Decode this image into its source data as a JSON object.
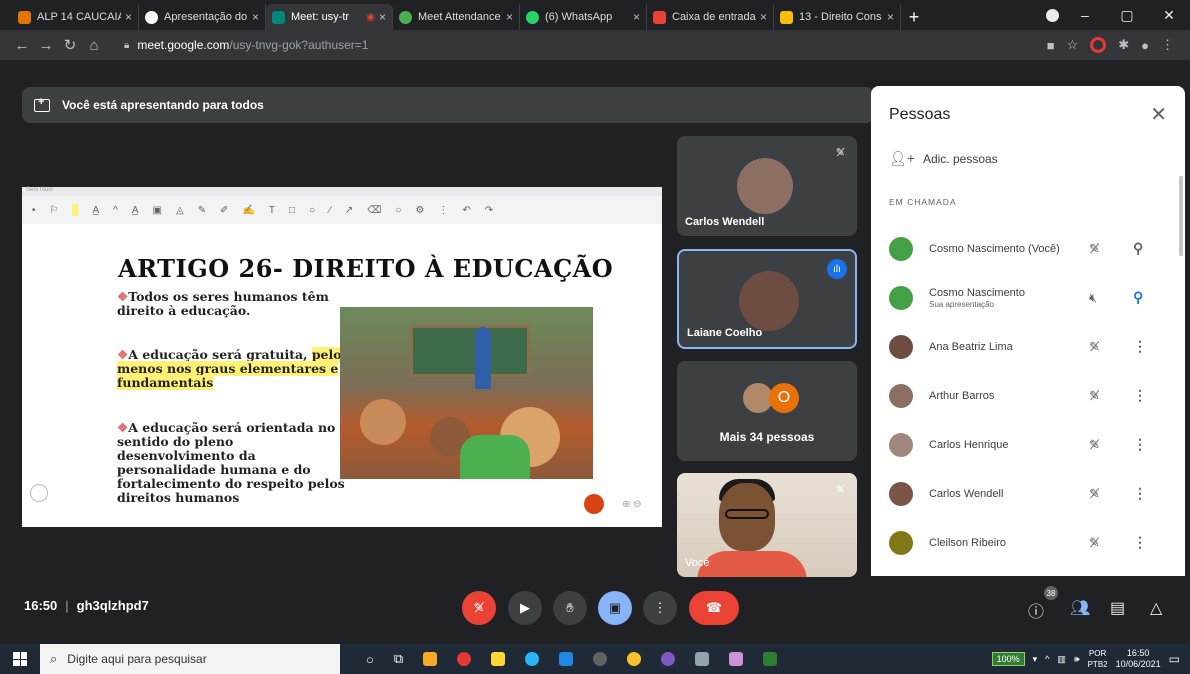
{
  "browser": {
    "tabs": [
      {
        "title": "ALP 14 CAUCAIA",
        "color": "#e37400",
        "active": false
      },
      {
        "title": "Apresentação do",
        "color": "#ffffff",
        "active": false
      },
      {
        "title": "Meet: usy-tr",
        "color": "#00897b",
        "active": true
      },
      {
        "title": "Meet Attendance",
        "color": "#4caf50",
        "active": false
      },
      {
        "title": "(6) WhatsApp",
        "color": "#25d366",
        "active": false
      },
      {
        "title": "Caixa de entrada",
        "color": "#ea4335",
        "active": false
      },
      {
        "title": "13 - Direito Cons",
        "color": "#fbbc04",
        "active": false
      }
    ],
    "tab_close": "×",
    "new_tab": "+",
    "window_controls": {
      "minimize": "–",
      "maximize": "▢",
      "close": "✕"
    },
    "url_host": "meet.google.com",
    "url_path": "/usy-tnvg-gok?authuser=1"
  },
  "meet": {
    "presenting_banner": "Você está apresentando para todos",
    "slide": {
      "window_title": "Sem título",
      "title": "ARTIGO 26- DIREITO À EDUCAÇÃO",
      "bullets": [
        {
          "marker": "❖",
          "text": "Todos os seres humanos têm direito à educação.",
          "highlight": ""
        },
        {
          "marker": "❖",
          "text": "A educação será gratuita,",
          "highlight": "pelo menos nos graus elementares e fundamentais"
        },
        {
          "marker": "❖",
          "text": "A educação será orientada no sentido do pleno desenvolvimento da personalidade humana e do fortalecimento do respeito pelos direitos humanos",
          "highlight": ""
        }
      ],
      "zoom_controls": "⊕ ⊖"
    },
    "tiles": [
      {
        "name": "Carlos Wendell",
        "muted": true
      },
      {
        "name": "Laiane Coelho",
        "speaking": true
      },
      {
        "more_label": "Mais 34 pessoas",
        "initial": "O"
      },
      {
        "name": "Você",
        "muted": true
      }
    ],
    "people_panel": {
      "title": "Pessoas",
      "add_label": "Adic. pessoas",
      "section_label": "EM CHAMADA",
      "participants": [
        {
          "name": "Cosmo Nascimento (Você)",
          "sub": "",
          "avatar_color": "#43a047",
          "action": "pin"
        },
        {
          "name": "Cosmo Nascimento",
          "sub": "Sua apresentação",
          "avatar_color": "#43a047",
          "action": "stop-present"
        },
        {
          "name": "Ana Beatriz Lima",
          "sub": "",
          "avatar_color": "#6d4c41",
          "action": "more"
        },
        {
          "name": "Arthur Barros",
          "sub": "",
          "avatar_color": "#8d6e63",
          "action": "more"
        },
        {
          "name": "Carlos Henrique",
          "sub": "",
          "avatar_color": "#a1887f",
          "action": "more"
        },
        {
          "name": "Carlos Wendell",
          "sub": "",
          "avatar_color": "#795548",
          "action": "more"
        },
        {
          "name": "Cleilson Ribeiro",
          "sub": "",
          "avatar_color": "#827717",
          "action": "more"
        }
      ]
    },
    "bottom_bar": {
      "time": "16:50",
      "separator": "|",
      "meeting_code": "gh3qlzhpd7",
      "people_count": "38"
    }
  },
  "taskbar": {
    "search_placeholder": "Digite aqui para pesquisar",
    "battery": "100%",
    "language_top": "POR",
    "language_bottom": "PTB2",
    "time": "16:50",
    "date": "10/06/2021"
  },
  "icons": {
    "mic_off": "🎙̸",
    "more": "⋮",
    "pin": "⚲"
  }
}
